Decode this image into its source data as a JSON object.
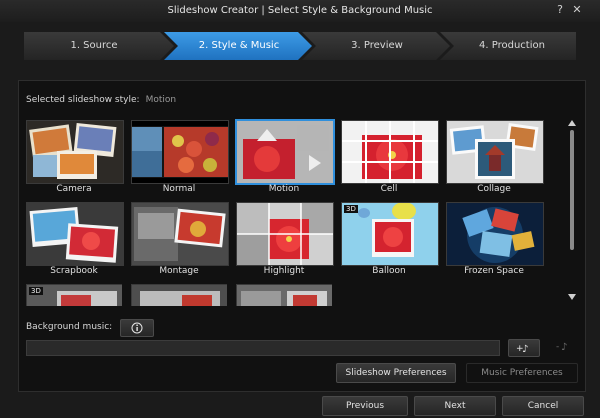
{
  "window": {
    "title": "Slideshow Creator | Select Style & Background Music",
    "help_glyph": "?",
    "close_glyph": "✕"
  },
  "steps": [
    {
      "label": "1. Source",
      "active": false
    },
    {
      "label": "2. Style & Music",
      "active": true
    },
    {
      "label": "3. Preview",
      "active": false
    },
    {
      "label": "4. Production",
      "active": false
    }
  ],
  "style_section": {
    "label": "Selected slideshow style:",
    "value": "Motion"
  },
  "styles": [
    {
      "name": "Camera",
      "three_d": false,
      "selected": false
    },
    {
      "name": "Normal",
      "three_d": false,
      "selected": false
    },
    {
      "name": "Motion",
      "three_d": false,
      "selected": true
    },
    {
      "name": "Cell",
      "three_d": false,
      "selected": false
    },
    {
      "name": "Collage",
      "three_d": false,
      "selected": false
    },
    {
      "name": "Scrapbook",
      "three_d": false,
      "selected": false
    },
    {
      "name": "Montage",
      "three_d": false,
      "selected": false
    },
    {
      "name": "Highlight",
      "three_d": false,
      "selected": false
    },
    {
      "name": "Balloon",
      "three_d": true,
      "selected": false
    },
    {
      "name": "Frozen Space",
      "three_d": false,
      "selected": false
    },
    {
      "name": "",
      "three_d": true,
      "selected": false
    },
    {
      "name": "",
      "three_d": false,
      "selected": false
    },
    {
      "name": "",
      "three_d": false,
      "selected": false
    }
  ],
  "three_d_badge": "3D",
  "music": {
    "label": "Background music:",
    "info_icon": "info-icon",
    "value": "",
    "add_icon": "add-music-icon",
    "remove_icon": "remove-music-icon"
  },
  "buttons": {
    "slideshow_prefs": "Slideshow Preferences",
    "music_prefs": "Music Preferences",
    "previous": "Previous",
    "next": "Next",
    "cancel": "Cancel"
  },
  "colors": {
    "accent": "#2f8fdc",
    "background": "#1b1b1b",
    "panel": "#111111"
  }
}
